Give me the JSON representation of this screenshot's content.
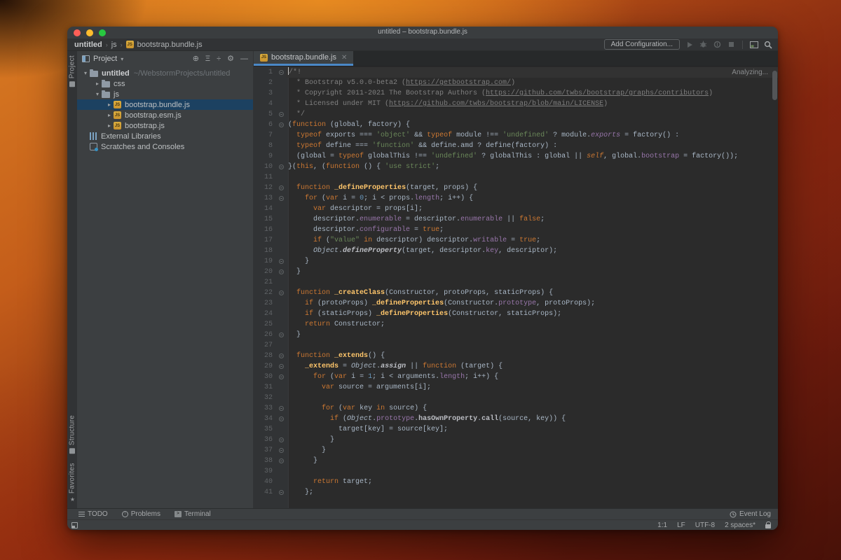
{
  "window": {
    "title": "untitled – bootstrap.bundle.js"
  },
  "breadcrumbs": {
    "items": [
      "untitled",
      "js",
      "bootstrap.bundle.js"
    ]
  },
  "toolbar": {
    "add_configuration": "Add Configuration..."
  },
  "tool_strip": {
    "project": "Project",
    "structure": "Structure",
    "favorites": "Favorites"
  },
  "project_panel": {
    "title": "Project",
    "tree": [
      {
        "icon": "folder",
        "chevron": "down",
        "label": "untitled",
        "bold": true,
        "path": "~/WebstormProjects/untitled",
        "depth": 0,
        "selected": false
      },
      {
        "icon": "folder",
        "chevron": "right",
        "label": "css",
        "depth": 1,
        "selected": false
      },
      {
        "icon": "folder",
        "chevron": "down",
        "label": "js",
        "depth": 1,
        "selected": false
      },
      {
        "icon": "js",
        "chevron": "right",
        "label": "bootstrap.bundle.js",
        "depth": 2,
        "selected": true
      },
      {
        "icon": "js",
        "chevron": "right",
        "label": "bootstrap.esm.js",
        "depth": 2,
        "selected": false
      },
      {
        "icon": "js",
        "chevron": "right",
        "label": "bootstrap.js",
        "depth": 2,
        "selected": false
      },
      {
        "icon": "lib",
        "chevron": "none",
        "label": "External Libraries",
        "depth": 0,
        "selected": false
      },
      {
        "icon": "scratch",
        "chevron": "none",
        "label": "Scratches and Consoles",
        "depth": 0,
        "selected": false
      }
    ]
  },
  "editor": {
    "tab": {
      "label": "bootstrap.bundle.js"
    },
    "analyzing": "Analyzing...",
    "lines": [
      {
        "n": 1,
        "fold": true,
        "active": true,
        "t": [
          [
            "c",
            "/*!"
          ]
        ]
      },
      {
        "n": 2,
        "fold": false,
        "t": [
          [
            "c",
            "  * Bootstrap v5.0.0-beta2 ("
          ],
          [
            "u",
            "https://getbootstrap.com/"
          ],
          [
            "c",
            ")"
          ]
        ]
      },
      {
        "n": 3,
        "fold": false,
        "t": [
          [
            "c",
            "  * Copyright 2011-2021 The Bootstrap Authors ("
          ],
          [
            "u",
            "https://github.com/twbs/bootstrap/graphs/contributors"
          ],
          [
            "c",
            ")"
          ]
        ]
      },
      {
        "n": 4,
        "fold": false,
        "t": [
          [
            "c",
            "  * Licensed under MIT ("
          ],
          [
            "u",
            "https://github.com/twbs/bootstrap/blob/main/LICENSE"
          ],
          [
            "c",
            ")"
          ]
        ]
      },
      {
        "n": 5,
        "fold": true,
        "t": [
          [
            "c",
            "  */"
          ]
        ]
      },
      {
        "n": 6,
        "fold": true,
        "t": [
          [
            "d",
            "("
          ],
          [
            "k",
            "function"
          ],
          [
            "d",
            " (global, factory) {"
          ]
        ]
      },
      {
        "n": 7,
        "fold": false,
        "t": [
          [
            "d",
            "  "
          ],
          [
            "k",
            "typeof"
          ],
          [
            "d",
            " exports === "
          ],
          [
            "s",
            "'object'"
          ],
          [
            "d",
            " && "
          ],
          [
            "k",
            "typeof"
          ],
          [
            "d",
            " module !== "
          ],
          [
            "s",
            "'undefined'"
          ],
          [
            "d",
            " ? module."
          ],
          [
            "pi",
            "exports"
          ],
          [
            "d",
            " = factory() :"
          ]
        ]
      },
      {
        "n": 8,
        "fold": false,
        "t": [
          [
            "d",
            "  "
          ],
          [
            "k",
            "typeof"
          ],
          [
            "d",
            " define === "
          ],
          [
            "s",
            "'function'"
          ],
          [
            "d",
            " && define.amd ? define(factory) :"
          ]
        ]
      },
      {
        "n": 9,
        "fold": false,
        "t": [
          [
            "d",
            "  (global = "
          ],
          [
            "k",
            "typeof"
          ],
          [
            "d",
            " globalThis !== "
          ],
          [
            "s",
            "'undefined'"
          ],
          [
            "d",
            " ? globalThis : global || "
          ],
          [
            "ki",
            "self"
          ],
          [
            "d",
            ", global."
          ],
          [
            "p",
            "bootstrap"
          ],
          [
            "d",
            " = factory());"
          ]
        ]
      },
      {
        "n": 10,
        "fold": true,
        "t": [
          [
            "d",
            "}("
          ],
          [
            "k",
            "this"
          ],
          [
            "d",
            ", ("
          ],
          [
            "k",
            "function"
          ],
          [
            "d",
            " () { "
          ],
          [
            "s",
            "'use strict'"
          ],
          [
            "d",
            ";"
          ]
        ]
      },
      {
        "n": 11,
        "fold": false,
        "t": []
      },
      {
        "n": 12,
        "fold": true,
        "t": [
          [
            "d",
            "  "
          ],
          [
            "k",
            "function"
          ],
          [
            "d",
            " "
          ],
          [
            "f",
            "_defineProperties"
          ],
          [
            "d",
            "(target, props) {"
          ]
        ]
      },
      {
        "n": 13,
        "fold": true,
        "t": [
          [
            "d",
            "    "
          ],
          [
            "k",
            "for"
          ],
          [
            "d",
            " ("
          ],
          [
            "k",
            "var"
          ],
          [
            "d",
            " i = "
          ],
          [
            "n",
            "0"
          ],
          [
            "d",
            "; i < props."
          ],
          [
            "p",
            "length"
          ],
          [
            "d",
            "; i++) {"
          ]
        ]
      },
      {
        "n": 14,
        "fold": false,
        "t": [
          [
            "d",
            "      "
          ],
          [
            "k",
            "var"
          ],
          [
            "d",
            " descriptor = props[i];"
          ]
        ]
      },
      {
        "n": 15,
        "fold": false,
        "t": [
          [
            "d",
            "      descriptor."
          ],
          [
            "p",
            "enumerable"
          ],
          [
            "d",
            " = descriptor."
          ],
          [
            "p",
            "enumerable"
          ],
          [
            "d",
            " || "
          ],
          [
            "k",
            "false"
          ],
          [
            "d",
            ";"
          ]
        ]
      },
      {
        "n": 16,
        "fold": false,
        "t": [
          [
            "d",
            "      descriptor."
          ],
          [
            "p",
            "configurable"
          ],
          [
            "d",
            " = "
          ],
          [
            "k",
            "true"
          ],
          [
            "d",
            ";"
          ]
        ]
      },
      {
        "n": 17,
        "fold": false,
        "t": [
          [
            "d",
            "      "
          ],
          [
            "k",
            "if"
          ],
          [
            "d",
            " ("
          ],
          [
            "s",
            "\"value\""
          ],
          [
            "d",
            " "
          ],
          [
            "k",
            "in"
          ],
          [
            "d",
            " descriptor) descriptor."
          ],
          [
            "p",
            "writable"
          ],
          [
            "d",
            " = "
          ],
          [
            "k",
            "true"
          ],
          [
            "d",
            ";"
          ]
        ]
      },
      {
        "n": 18,
        "fold": false,
        "t": [
          [
            "d",
            "      "
          ],
          [
            "i",
            "Object"
          ],
          [
            "d",
            "."
          ],
          [
            "bi",
            "defineProperty"
          ],
          [
            "d",
            "(target, descriptor."
          ],
          [
            "p",
            "key"
          ],
          [
            "d",
            ", descriptor);"
          ]
        ]
      },
      {
        "n": 19,
        "fold": true,
        "t": [
          [
            "d",
            "    }"
          ]
        ]
      },
      {
        "n": 20,
        "fold": true,
        "t": [
          [
            "d",
            "  }"
          ]
        ]
      },
      {
        "n": 21,
        "fold": false,
        "t": []
      },
      {
        "n": 22,
        "fold": true,
        "t": [
          [
            "d",
            "  "
          ],
          [
            "k",
            "function"
          ],
          [
            "d",
            " "
          ],
          [
            "f",
            "_createClass"
          ],
          [
            "d",
            "(Constructor, protoProps, staticProps) {"
          ]
        ]
      },
      {
        "n": 23,
        "fold": false,
        "t": [
          [
            "d",
            "    "
          ],
          [
            "k",
            "if"
          ],
          [
            "d",
            " (protoProps) "
          ],
          [
            "f",
            "_defineProperties"
          ],
          [
            "d",
            "(Constructor."
          ],
          [
            "p",
            "prototype"
          ],
          [
            "d",
            ", protoProps);"
          ]
        ]
      },
      {
        "n": 24,
        "fold": false,
        "t": [
          [
            "d",
            "    "
          ],
          [
            "k",
            "if"
          ],
          [
            "d",
            " (staticProps) "
          ],
          [
            "f",
            "_defineProperties"
          ],
          [
            "d",
            "(Constructor, staticProps);"
          ]
        ]
      },
      {
        "n": 25,
        "fold": false,
        "t": [
          [
            "d",
            "    "
          ],
          [
            "k",
            "return"
          ],
          [
            "d",
            " Constructor;"
          ]
        ]
      },
      {
        "n": 26,
        "fold": true,
        "t": [
          [
            "d",
            "  }"
          ]
        ]
      },
      {
        "n": 27,
        "fold": false,
        "t": []
      },
      {
        "n": 28,
        "fold": true,
        "t": [
          [
            "d",
            "  "
          ],
          [
            "k",
            "function"
          ],
          [
            "d",
            " "
          ],
          [
            "f",
            "_extends"
          ],
          [
            "d",
            "() {"
          ]
        ]
      },
      {
        "n": 29,
        "fold": true,
        "t": [
          [
            "d",
            "    "
          ],
          [
            "f",
            "_extends"
          ],
          [
            "d",
            " = "
          ],
          [
            "i",
            "Object"
          ],
          [
            "d",
            "."
          ],
          [
            "bi",
            "assign"
          ],
          [
            "d",
            " || "
          ],
          [
            "k",
            "function"
          ],
          [
            "d",
            " (target) {"
          ]
        ]
      },
      {
        "n": 30,
        "fold": true,
        "t": [
          [
            "d",
            "      "
          ],
          [
            "k",
            "for"
          ],
          [
            "d",
            " ("
          ],
          [
            "k",
            "var"
          ],
          [
            "d",
            " i = "
          ],
          [
            "n",
            "1"
          ],
          [
            "d",
            "; i < arguments."
          ],
          [
            "p",
            "length"
          ],
          [
            "d",
            "; i++) {"
          ]
        ]
      },
      {
        "n": 31,
        "fold": false,
        "t": [
          [
            "d",
            "        "
          ],
          [
            "k",
            "var"
          ],
          [
            "d",
            " source = arguments[i];"
          ]
        ]
      },
      {
        "n": 32,
        "fold": false,
        "t": []
      },
      {
        "n": 33,
        "fold": true,
        "t": [
          [
            "d",
            "        "
          ],
          [
            "k",
            "for"
          ],
          [
            "d",
            " ("
          ],
          [
            "k",
            "var"
          ],
          [
            "d",
            " key "
          ],
          [
            "k",
            "in"
          ],
          [
            "d",
            " source) {"
          ]
        ]
      },
      {
        "n": 34,
        "fold": true,
        "t": [
          [
            "d",
            "          "
          ],
          [
            "k",
            "if"
          ],
          [
            "d",
            " ("
          ],
          [
            "i",
            "Object"
          ],
          [
            "d",
            "."
          ],
          [
            "p",
            "prototype"
          ],
          [
            "d",
            "."
          ],
          [
            "b",
            "hasOwnProperty"
          ],
          [
            "d",
            "."
          ],
          [
            "b",
            "call"
          ],
          [
            "d",
            "(source, key)) {"
          ]
        ]
      },
      {
        "n": 35,
        "fold": false,
        "t": [
          [
            "d",
            "            target[key] = source[key];"
          ]
        ]
      },
      {
        "n": 36,
        "fold": true,
        "t": [
          [
            "d",
            "          }"
          ]
        ]
      },
      {
        "n": 37,
        "fold": true,
        "t": [
          [
            "d",
            "        }"
          ]
        ]
      },
      {
        "n": 38,
        "fold": true,
        "t": [
          [
            "d",
            "      }"
          ]
        ]
      },
      {
        "n": 39,
        "fold": false,
        "t": []
      },
      {
        "n": 40,
        "fold": false,
        "t": [
          [
            "d",
            "      "
          ],
          [
            "k",
            "return"
          ],
          [
            "d",
            " target;"
          ]
        ]
      },
      {
        "n": 41,
        "fold": true,
        "t": [
          [
            "d",
            "    };"
          ]
        ]
      }
    ]
  },
  "bottom_bar": {
    "todo": "TODO",
    "problems": "Problems",
    "terminal": "Terminal",
    "event_log": "Event Log"
  },
  "status_bar": {
    "position": "1:1",
    "line_ending": "LF",
    "encoding": "UTF-8",
    "indent": "2 spaces*"
  },
  "colors": {
    "editor_bg": "#2b2b2b",
    "panel_bg": "#3c3f41",
    "accent_blue": "#4a88c7",
    "selection_blue": "#1c4161",
    "keyword_orange": "#cc7832",
    "string_green": "#6a8759",
    "number_blue": "#6897bb",
    "comment_gray": "#808080",
    "function_yellow": "#ffc66b",
    "property_purple": "#9876aa",
    "traffic_red": "#ff5f57",
    "traffic_yellow": "#febc2e",
    "traffic_green": "#28c840"
  }
}
